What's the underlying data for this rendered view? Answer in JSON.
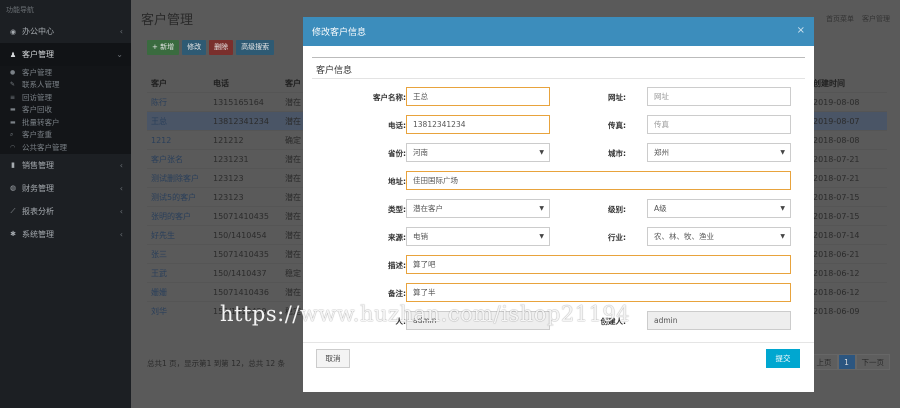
{
  "sidebar": {
    "brand": "功能导航",
    "items": [
      {
        "label": "办公中心",
        "icon": "dashboard-icon"
      },
      {
        "label": "客户管理",
        "icon": "user-icon",
        "active": true
      },
      {
        "label": "销售管理",
        "icon": "chart-icon"
      },
      {
        "label": "财务管理",
        "icon": "money-icon"
      },
      {
        "label": "报表分析",
        "icon": "report-icon"
      },
      {
        "label": "系统管理",
        "icon": "gear-icon"
      }
    ],
    "sub_items": [
      "客户管理",
      "联系人管理",
      "回访管理",
      "客户回收",
      "批量转客户",
      "客户查重",
      "公共客户管理"
    ]
  },
  "main": {
    "title": "客户管理",
    "crumbs": [
      "首页菜单",
      "客户管理"
    ],
    "toolbar": {
      "add": "+ 新增",
      "edit": "修改",
      "delete": "删除",
      "search": "高级搜索"
    },
    "columns": [
      "客户",
      "电话",
      "客户",
      "创建时间"
    ],
    "rows": [
      {
        "name": "陈行",
        "phone": "1315165164",
        "c3": "潜在",
        "date": "2019-08-08",
        "hl": false
      },
      {
        "name": "王总",
        "phone": "13812341234",
        "c3": "潜在",
        "date": "2019-08-07",
        "hl": true
      },
      {
        "name": "1212",
        "phone": "121212",
        "c3": "确定",
        "date": "2018-08-08",
        "hl": false
      },
      {
        "name": "客户张名",
        "phone": "1231231",
        "c3": "潜在",
        "date": "2018-07-21",
        "hl": false
      },
      {
        "name": "测试删除客户",
        "phone": "123123",
        "c3": "潜在",
        "date": "2018-07-21",
        "hl": false
      },
      {
        "name": "测试5的客户",
        "phone": "123123",
        "c3": "潜在",
        "date": "2018-07-15",
        "hl": false
      },
      {
        "name": "张明的客户",
        "phone": "15071410435",
        "c3": "潜在",
        "date": "2018-07-15",
        "hl": false
      },
      {
        "name": "好先生",
        "phone": "150/1410454",
        "c3": "潜在",
        "date": "2018-07-14",
        "hl": false
      },
      {
        "name": "张三",
        "phone": "15071410435",
        "c3": "潜在",
        "date": "2018-06-21",
        "hl": false
      },
      {
        "name": "王武",
        "phone": "150/1410437",
        "c3": "稳定",
        "date": "2018-06-12",
        "hl": false
      },
      {
        "name": "姗姗",
        "phone": "15071410436",
        "c3": "潜在",
        "date": "2018-06-12",
        "hl": false
      },
      {
        "name": "刘华",
        "phone": "150/1410439",
        "c3": "稳定",
        "date": "2018-06-09",
        "hl": false
      }
    ],
    "footer": "总共1 页，显示第1 到第 12，总共 12 条",
    "pager": [
      "上页",
      "1",
      "下一页"
    ]
  },
  "modal": {
    "title": "修改客户信息",
    "close": "×",
    "section": "客户信息",
    "fields": {
      "name_label": "客户名称:",
      "name_value": "王总",
      "url_label": "网址:",
      "url_placeholder": "网址",
      "phone_label": "电话:",
      "phone_value": "13812341234",
      "fax_label": "传真:",
      "fax_placeholder": "传真",
      "province_label": "省份:",
      "province_value": "河南",
      "city_label": "城市:",
      "city_value": "郑州",
      "address_label": "地址:",
      "address_value": "佳田国际广场",
      "type_label": "类型:",
      "type_value": "潜在客户",
      "level_label": "级别:",
      "level_value": "A级",
      "source_label": "来源:",
      "source_value": "电销",
      "industry_label": "行业:",
      "industry_value": "农、林、牧、渔业",
      "desc_label": "描述:",
      "desc_value": "算了吧",
      "note_label": "备注:",
      "note_value": "算了半",
      "owner_label": "人:",
      "owner_value": "admin",
      "creator_label": "创建人:",
      "creator_value": "admin"
    },
    "cancel": "取消",
    "submit": "提交"
  },
  "watermark": "https://www.huzhan.com/ishop21194"
}
